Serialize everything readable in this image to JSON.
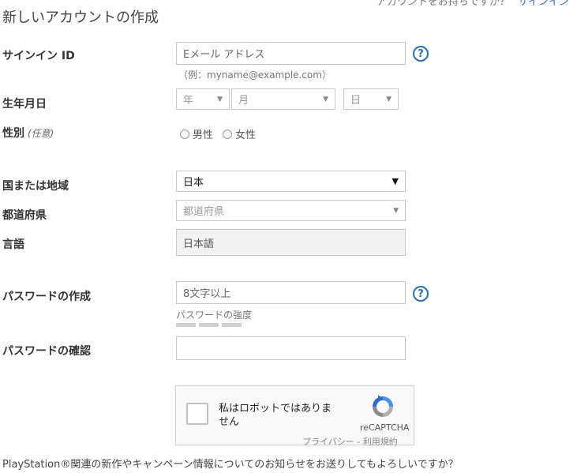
{
  "header": {
    "account_question": "アカウントをお持ちですか？",
    "signin_link": "サインイン"
  },
  "form": {
    "title": "新しいアカウントの作成",
    "signin_id": {
      "label": "サインイン ID",
      "placeholder": "Eメール アドレス",
      "example": "（例：myname@example.com）",
      "help": "?"
    },
    "birthdate": {
      "label": "生年月日",
      "year": "年",
      "month": "月",
      "day": "日",
      "arrow": "▼"
    },
    "gender": {
      "label": "性別",
      "optional": "(任意)",
      "options": [
        "男性",
        "女性"
      ]
    },
    "country": {
      "label": "国または地域",
      "value": "日本",
      "arrow": "▼"
    },
    "prefecture": {
      "label": "都道府県",
      "placeholder": "都道府県",
      "arrow": "▼"
    },
    "language": {
      "label": "言語",
      "value": "日本語"
    },
    "password": {
      "label": "パスワードの作成",
      "placeholder": "8文字以上",
      "strength_label": "パスワードの強度",
      "help": "?",
      "strength_level": 0
    },
    "password_confirm": {
      "label": "パスワードの確認",
      "value": ""
    },
    "captcha": {
      "text": "私はロボットではありません",
      "brand": "reCAPTCHA",
      "links": "プライバシー - 利用規約"
    },
    "newsletter_question": "PlayStation®関連の新作やキャンペーン情報についてのお知らせをお送りしてもよろしいですか？"
  },
  "colors": {
    "link": "#2b6fb6",
    "border": "#c8c8c8",
    "readonly_bg": "#f2f2f2"
  }
}
